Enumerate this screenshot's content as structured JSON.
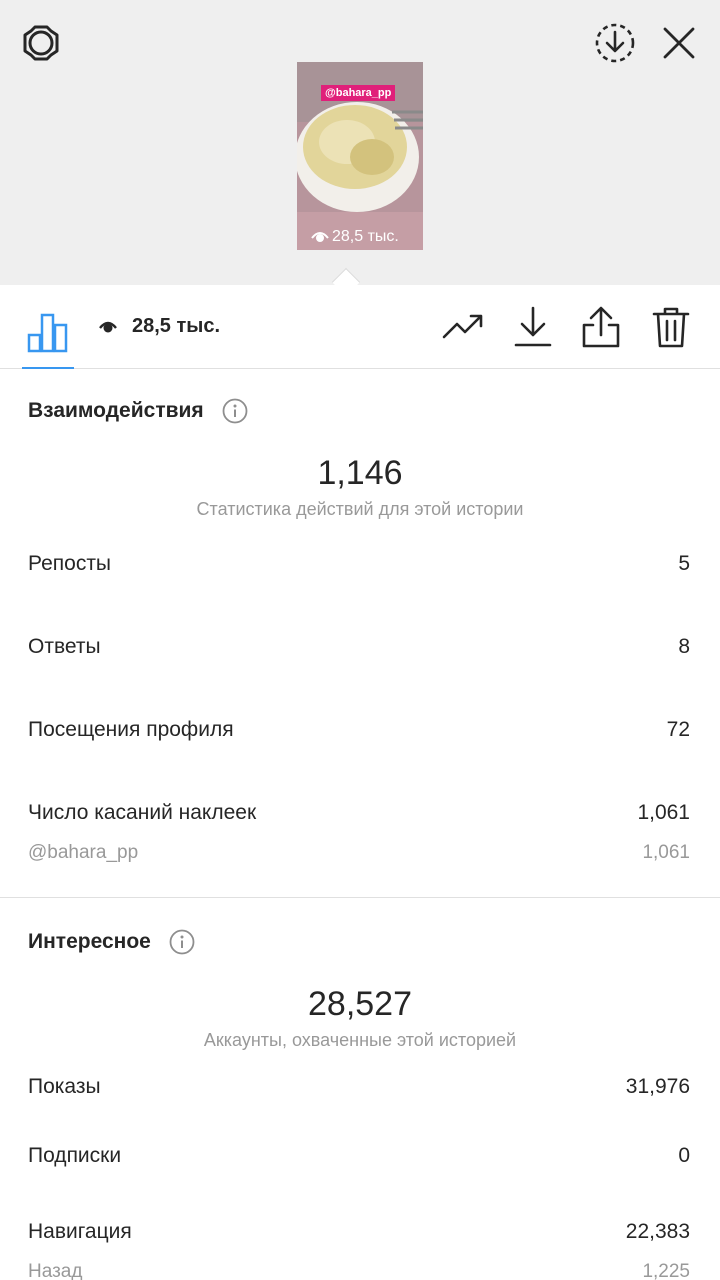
{
  "story": {
    "sticker": "@bahara_pp",
    "views": "28,5 тыс."
  },
  "toolbar": {
    "views": "28,5 тыс."
  },
  "interactions": {
    "title": "Взаимодействия",
    "total": "1,146",
    "caption": "Статистика действий для этой истории",
    "rows": [
      {
        "label": "Репосты",
        "value": "5"
      },
      {
        "label": "Ответы",
        "value": "8"
      },
      {
        "label": "Посещения профиля",
        "value": "72"
      },
      {
        "label": "Число касаний наклеек",
        "value": "1,061"
      }
    ],
    "sub_row": {
      "label": "@bahara_pp",
      "value": "1,061"
    }
  },
  "discovery": {
    "title": "Интересное",
    "total": "28,527",
    "caption": "Аккаунты, охваченные этой историей",
    "rows": [
      {
        "label": "Показы",
        "value": "31,976"
      },
      {
        "label": "Подписки",
        "value": "0"
      },
      {
        "label": "Навигация",
        "value": "22,383"
      }
    ],
    "sub_row": {
      "label": "Назад",
      "value": "1,225"
    }
  },
  "colors": {
    "accent": "#3897f0",
    "sticker": "#e0207a",
    "secondary_text": "#999999"
  },
  "icons": [
    "settings-icon",
    "archive-download-icon",
    "close-icon",
    "bar-chart-icon",
    "eye-icon",
    "trending-icon",
    "download-icon",
    "share-icon",
    "trash-icon",
    "info-icon"
  ]
}
